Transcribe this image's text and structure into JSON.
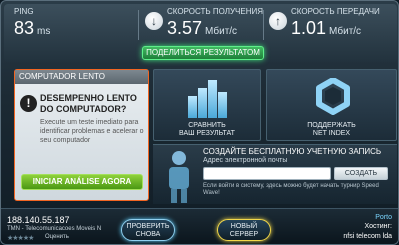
{
  "stats": {
    "ping": {
      "label": "PING",
      "value": "83",
      "unit": "ms"
    },
    "download": {
      "label": "СКОРОСТЬ ПОЛУЧЕНИЯ",
      "value": "3.57",
      "unit": "Мбит/с"
    },
    "upload": {
      "label": "СКОРОСТЬ ПЕРЕДАЧИ",
      "value": "1.01",
      "unit": "Мбит/с"
    }
  },
  "share_button": "ПОДЕЛИТЬСЯ РЕЗУЛЬТАТОМ",
  "slow_panel": {
    "header": "COMPUTADOR LENTO",
    "title_line1": "DESEMPENHO LENTO",
    "title_line2": "DO COMPUTADOR?",
    "description": "Execute um teste imediato para identificar problemas e acelerar o seu computador",
    "button": "INICIAR ANÁLISE AGORA"
  },
  "tiles": {
    "compare_line1": "СРАВНИТЬ",
    "compare_line2": "ВАШ РЕЗУЛЬТАТ",
    "support_line1": "ПОДДЕРЖАТЬ",
    "support_line2": "NET INDEX"
  },
  "register": {
    "title": "СОЗДАЙТЕ БЕСПЛАТНУЮ УЧЕТНУЮ ЗАПИСЬ",
    "email_label": "Адрес электронной почты",
    "email_placeholder": "",
    "create_button": "СОЗДАТЬ",
    "note": "Если войти в систему, здесь можно будет начать турнир Speed Wave!"
  },
  "bottom": {
    "ip": "188.140.55.187",
    "isp": "TMN - Telecomunicacoes Moveis N",
    "stars": "★★★★★",
    "rate_label": "Оценить",
    "retest_line1": "ПРОВЕРИТЬ",
    "retest_line2": "СНОВА",
    "newserver_line1": "НОВЫЙ",
    "newserver_line2": "СЕРВЕР",
    "server_city": "Porto",
    "host_label": "Хостинг:",
    "host_name": "nfsi telecom lda"
  }
}
